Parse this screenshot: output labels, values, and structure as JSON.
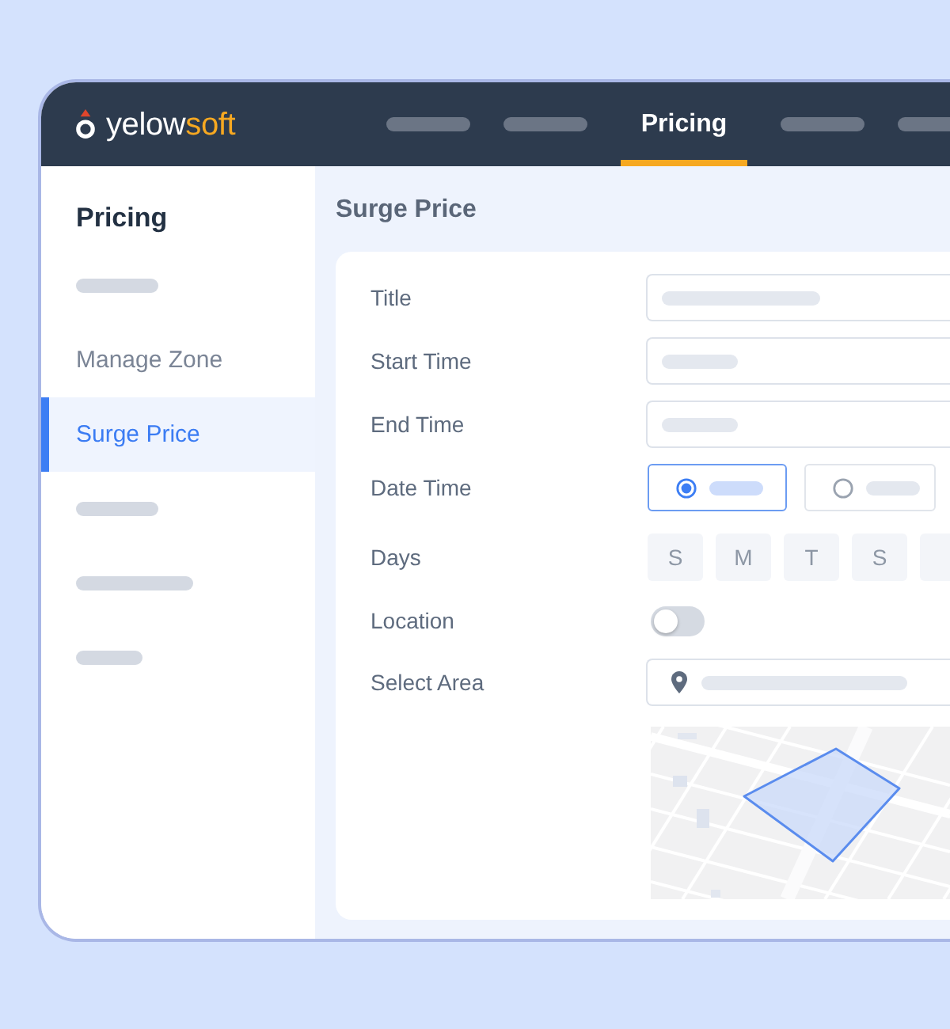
{
  "header": {
    "logo": {
      "text": "yelow",
      "accent_text": "soft"
    },
    "nav": [
      {
        "kind": "placeholder",
        "selected": false
      },
      {
        "kind": "placeholder",
        "selected": false
      },
      {
        "kind": "tab",
        "label": "Pricing",
        "selected": true
      },
      {
        "kind": "placeholder",
        "selected": false
      },
      {
        "kind": "placeholder",
        "selected": false
      }
    ]
  },
  "sidebar": {
    "title": "Pricing",
    "items": [
      {
        "kind": "bar",
        "selected": false
      },
      {
        "kind": "link",
        "label": "Manage Zone",
        "selected": false
      },
      {
        "kind": "link",
        "label": "Surge Price",
        "selected": true
      },
      {
        "kind": "bar",
        "selected": false
      },
      {
        "kind": "longbar",
        "selected": false
      },
      {
        "kind": "shortbar",
        "selected": false
      }
    ]
  },
  "main": {
    "title": "Surge Price",
    "form": {
      "rows": [
        {
          "kind": "text",
          "label": "Title"
        },
        {
          "kind": "time",
          "label": "Start Time"
        },
        {
          "kind": "time",
          "label": "End Time"
        },
        {
          "kind": "radio",
          "label": "Date Time",
          "options": [
            {
              "selected": true
            },
            {
              "selected": false
            }
          ]
        },
        {
          "kind": "days",
          "label": "Days",
          "days": [
            "S",
            "M",
            "T",
            "S"
          ]
        },
        {
          "kind": "toggle",
          "label": "Location",
          "on": false
        },
        {
          "kind": "select",
          "label": "Select Area"
        },
        {
          "kind": "map"
        }
      ]
    }
  }
}
